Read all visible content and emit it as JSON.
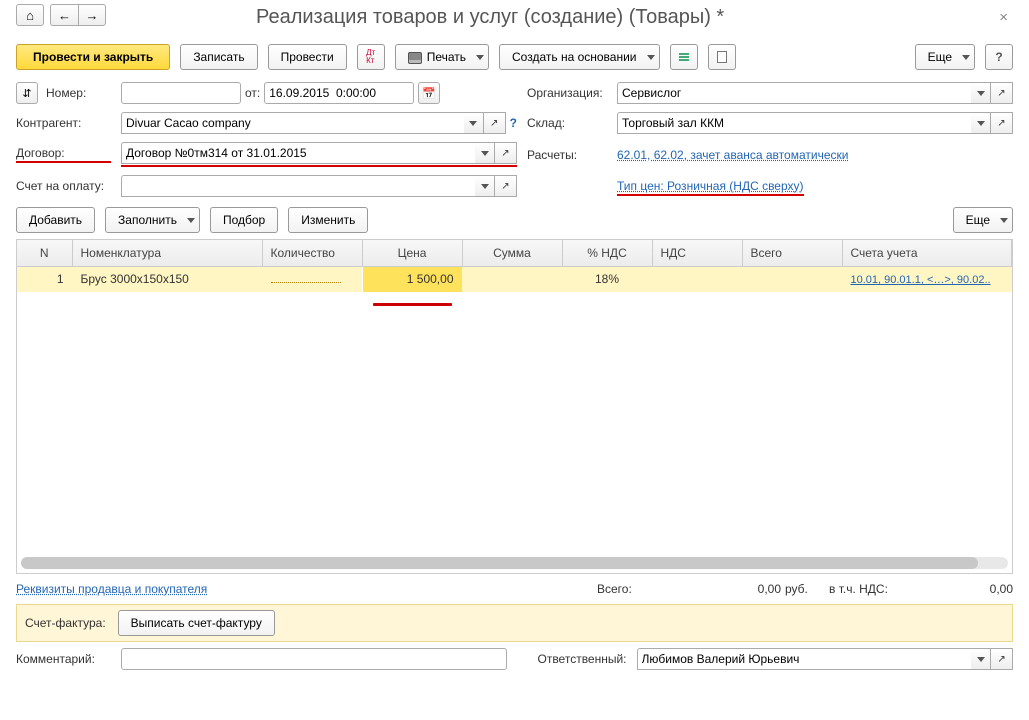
{
  "nav": {
    "home": "⌂",
    "back": "←",
    "fwd": "→"
  },
  "title": "Реализация товаров и услуг (создание) (Товары) *",
  "toolbar": {
    "provesti_zakryt": "Провести и закрыть",
    "zapisat": "Записать",
    "provesti": "Провести",
    "pechat": "Печать",
    "sozdat_na_osnovanii": "Создать на основании",
    "esche": "Еще",
    "help": "?",
    "dt_kt": "Дт\nКт"
  },
  "form": {
    "nomer_lbl": "Номер:",
    "nomer_val": "",
    "ot_lbl": "от:",
    "date_val": "16.09.2015  0:00:00",
    "org_lbl": "Организация:",
    "org_val": "Сервислог",
    "kontragent_lbl": "Контрагент:",
    "kontragent_val": "Divuar Cacao company",
    "sklad_lbl": "Склад:",
    "sklad_val": "Торговый зал ККМ",
    "dogovor_lbl": "Договор:",
    "dogovor_val": "Договор №0тм314 от 31.01.2015",
    "raschety_lbl": "Расчеты:",
    "raschety_link": "62.01, 62.02, зачет аванса автоматически",
    "schet_oplatu_lbl": "Счет на оплату:",
    "schet_oplatu_val": "",
    "tip_cen_link": "Тип цен: Розничная (НДС сверху)"
  },
  "table_toolbar": {
    "dobavit": "Добавить",
    "zapolnit": "Заполнить",
    "podbor": "Подбор",
    "izmenit": "Изменить",
    "esche": "Еще"
  },
  "columns": {
    "n": "N",
    "nomenklatura": "Номенклатура",
    "kolichestvo": "Количество",
    "cena": "Цена",
    "summa": "Сумма",
    "pct_nds": "% НДС",
    "nds": "НДС",
    "vsego": "Всего",
    "scheta_ucheta": "Счета учета"
  },
  "row": {
    "n": "1",
    "nomenklatura": "Брус 3000х150х150",
    "kolichestvo": "",
    "cena": "1 500,00",
    "summa": "",
    "pct_nds": "18%",
    "nds": "",
    "vsego": "",
    "scheta": "10.01, 90.01.1, <…>, 90.02.."
  },
  "links": {
    "rekvizity": "Реквизиты продавца и покупателя"
  },
  "totals": {
    "vsego_lbl": "Всего:",
    "vsego_val": "0,00",
    "rub": "руб.",
    "vtch_lbl": "в т.ч. НДС:",
    "vtch_val": "0,00"
  },
  "invoice": {
    "lbl": "Счет-фактура:",
    "btn": "Выписать счет-фактуру"
  },
  "bottom": {
    "kommentariy_lbl": "Комментарий:",
    "kommentariy_val": "",
    "otvetstvennyy_lbl": "Ответственный:",
    "otvetstvennyy_val": "Любимов Валерий Юрьевич"
  }
}
